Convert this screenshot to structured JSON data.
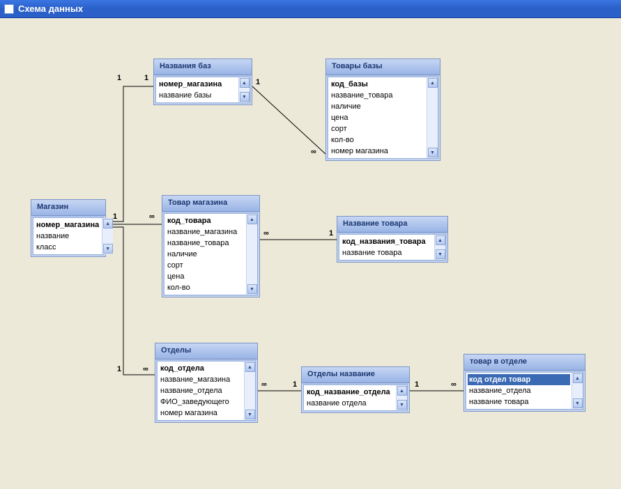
{
  "window": {
    "title": "Схема данных"
  },
  "tables": {
    "nazvaniya_baz": {
      "title": "Названия баз",
      "fields": [
        {
          "name": "номер_магазина",
          "pk": true
        },
        {
          "name": "название базы"
        }
      ]
    },
    "tovary_bazy": {
      "title": "Товары базы",
      "fields": [
        {
          "name": "код_базы",
          "pk": true
        },
        {
          "name": "название_товара"
        },
        {
          "name": "наличие"
        },
        {
          "name": "цена"
        },
        {
          "name": "сорт"
        },
        {
          "name": "кол-во"
        },
        {
          "name": "номер магазина"
        }
      ]
    },
    "magazin": {
      "title": "Магазин",
      "fields": [
        {
          "name": "номер_магазина",
          "pk": true
        },
        {
          "name": "название"
        },
        {
          "name": "класс"
        }
      ]
    },
    "tovar_magazina": {
      "title": "Товар магазина",
      "fields": [
        {
          "name": "код_товара",
          "pk": true
        },
        {
          "name": "название_магазина"
        },
        {
          "name": "название_товара"
        },
        {
          "name": "наличие"
        },
        {
          "name": "сорт"
        },
        {
          "name": "цена"
        },
        {
          "name": "кол-во"
        }
      ]
    },
    "nazvanie_tovara": {
      "title": "Название товара",
      "fields": [
        {
          "name": "код_названия_товара",
          "pk": true
        },
        {
          "name": "название товара"
        }
      ]
    },
    "otdely": {
      "title": "Отделы",
      "fields": [
        {
          "name": "код_отдела",
          "pk": true
        },
        {
          "name": "название_магазина"
        },
        {
          "name": "название_отдела"
        },
        {
          "name": "ФИО_заведующего"
        },
        {
          "name": "номер магазина"
        }
      ]
    },
    "otdely_nazvanie": {
      "title": "Отделы название",
      "fields": [
        {
          "name": "код_название_отдела",
          "pk": true
        },
        {
          "name": "название отдела"
        }
      ]
    },
    "tovar_v_otdele": {
      "title": "товар в отделе",
      "fields": [
        {
          "name": "код отдел товар",
          "pk": true,
          "selected": true
        },
        {
          "name": "название_отдела"
        },
        {
          "name": "название товара"
        }
      ]
    }
  },
  "relations": [
    {
      "left_card": "1",
      "right_card": "1"
    },
    {
      "left_card": "1",
      "right_card": "∞"
    },
    {
      "left_card": "1",
      "right_card": "∞"
    },
    {
      "left_card": "∞",
      "right_card": "1"
    },
    {
      "left_card": "1",
      "right_card": "∞"
    },
    {
      "left_card": "∞",
      "right_card": "1"
    },
    {
      "left_card": "1",
      "right_card": "∞"
    }
  ],
  "chart_data": {
    "type": "table",
    "description": "Database relationship (ER) diagram with 8 entity tables and 7 relationships",
    "entities": [
      "Названия баз",
      "Товары базы",
      "Магазин",
      "Товар магазина",
      "Название товара",
      "Отделы",
      "Отделы название",
      "товар в отделе"
    ],
    "relationships": [
      {
        "from": "Магазин",
        "to": "Названия баз",
        "cardinality": "1 — 1"
      },
      {
        "from": "Названия баз",
        "to": "Товары базы",
        "cardinality": "1 — ∞"
      },
      {
        "from": "Магазин",
        "to": "Товар магазина",
        "cardinality": "1 — ∞"
      },
      {
        "from": "Товар магазина",
        "to": "Название товара",
        "cardinality": "∞ — 1"
      },
      {
        "from": "Магазин",
        "to": "Отделы",
        "cardinality": "1 — ∞"
      },
      {
        "from": "Отделы",
        "to": "Отделы название",
        "cardinality": "∞ — 1"
      },
      {
        "from": "Отделы название",
        "to": "товар в отделе",
        "cardinality": "1 — ∞"
      }
    ]
  }
}
